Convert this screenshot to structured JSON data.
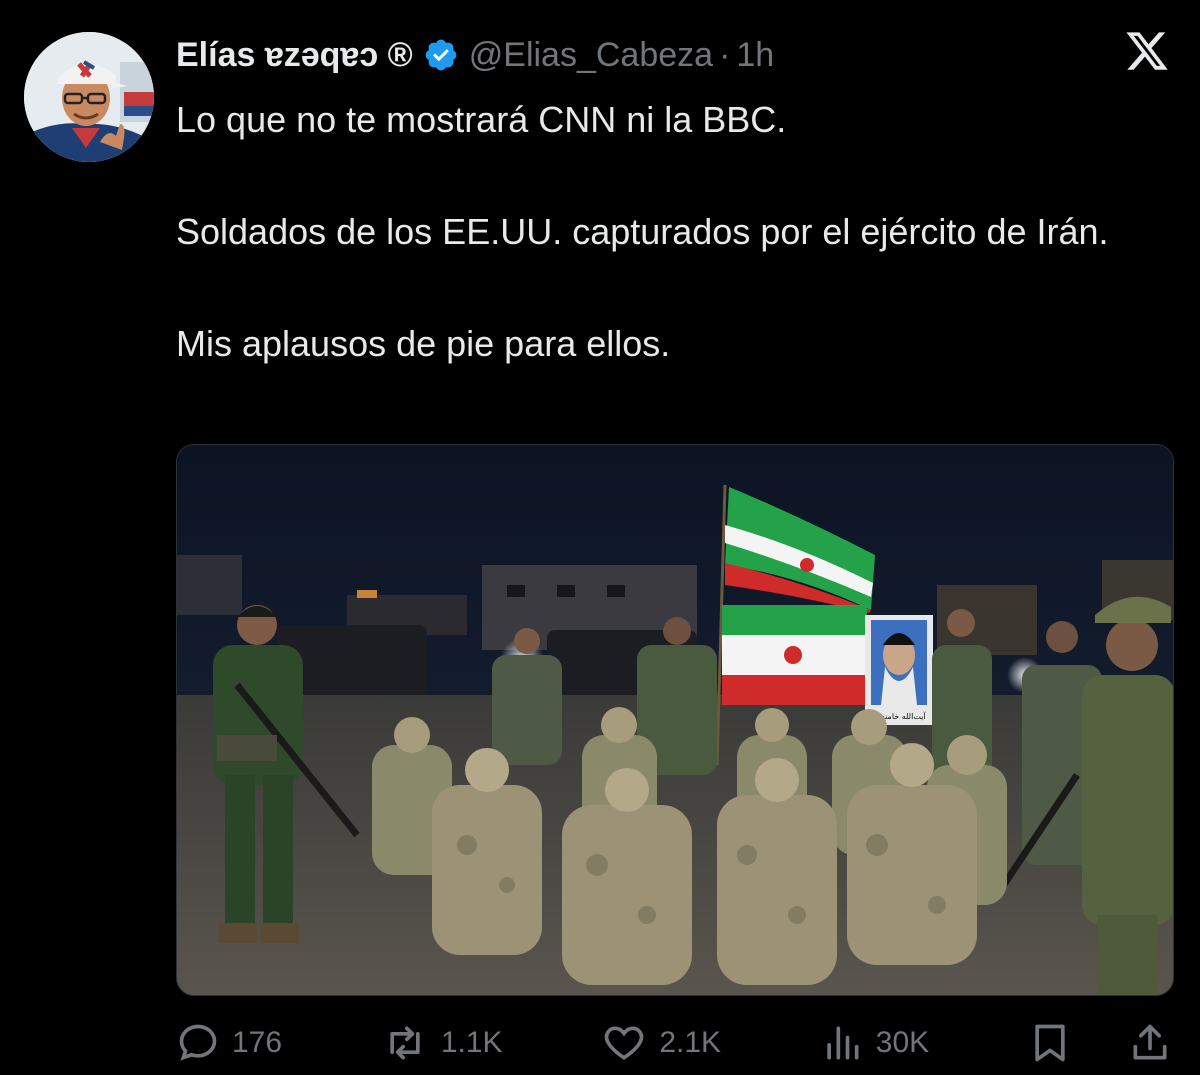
{
  "author": {
    "display_name": "Elías ɐzǝqɐɔ ®",
    "handle": "@Elias_Cabeza",
    "separator": "·",
    "time": "1h",
    "verified": true
  },
  "tweet": {
    "paragraphs": [
      "Lo que no te mostrará CNN ni la BBC.",
      "Soldados de los EE.UU. capturados por el ejército de Irán.",
      "Mis aplausos de pie para ellos."
    ]
  },
  "media": {
    "poster_caption": "آیت‌الله خامنه‌ای"
  },
  "actions": {
    "replies": "176",
    "reposts": "1.1K",
    "likes": "2.1K",
    "views": "30K"
  },
  "icons": {
    "close": "x-logo-icon",
    "reply": "reply-icon",
    "repost": "repost-icon",
    "like": "heart-icon",
    "views": "views-icon",
    "bookmark": "bookmark-icon",
    "share": "share-icon",
    "verified": "verified-badge-icon"
  },
  "colors": {
    "background": "#000000",
    "text": "#e7e9ea",
    "muted": "#71767b",
    "verified": "#1d9bf0"
  }
}
